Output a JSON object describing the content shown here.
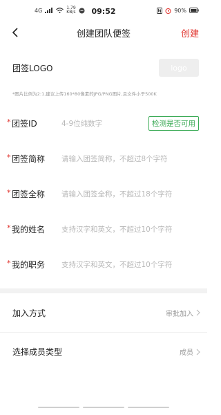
{
  "status_bar": {
    "network": "4G",
    "signal": "4G ıl",
    "speed": "1.79 KB/s",
    "time": "09:52",
    "battery": "90%"
  },
  "nav": {
    "title": "创建团队便签",
    "create_label": "创建"
  },
  "logo_section": {
    "label": "团签LOGO",
    "button_label": "logo",
    "hint": "*图片比例为2:1,建议上传160*80像素的JPG/PNG图片,且文件小于500K"
  },
  "fields": [
    {
      "required": "*",
      "label": "团签ID",
      "placeholder": "4-9位纯数字",
      "action": "检测是否可用"
    },
    {
      "required": "*",
      "label": "团签简称",
      "placeholder": "请输入团签简称，不超过8个字符"
    },
    {
      "required": "*",
      "label": "团签全称",
      "placeholder": "请输入团签全称，不超过18个字符"
    },
    {
      "required": "*",
      "label": "我的姓名",
      "placeholder": "支持汉字和英文，不超过10个字符"
    },
    {
      "required": "*",
      "label": "我的职务",
      "placeholder": "支持汉字和英文，不超过10个字符"
    }
  ],
  "options": [
    {
      "label": "加入方式",
      "value": "审批加入"
    },
    {
      "label": "选择成员类型",
      "value": "成员"
    }
  ],
  "colors": {
    "accent": "#e0302a",
    "check_green": "#3aaa55",
    "placeholder": "#b8b8b8"
  }
}
